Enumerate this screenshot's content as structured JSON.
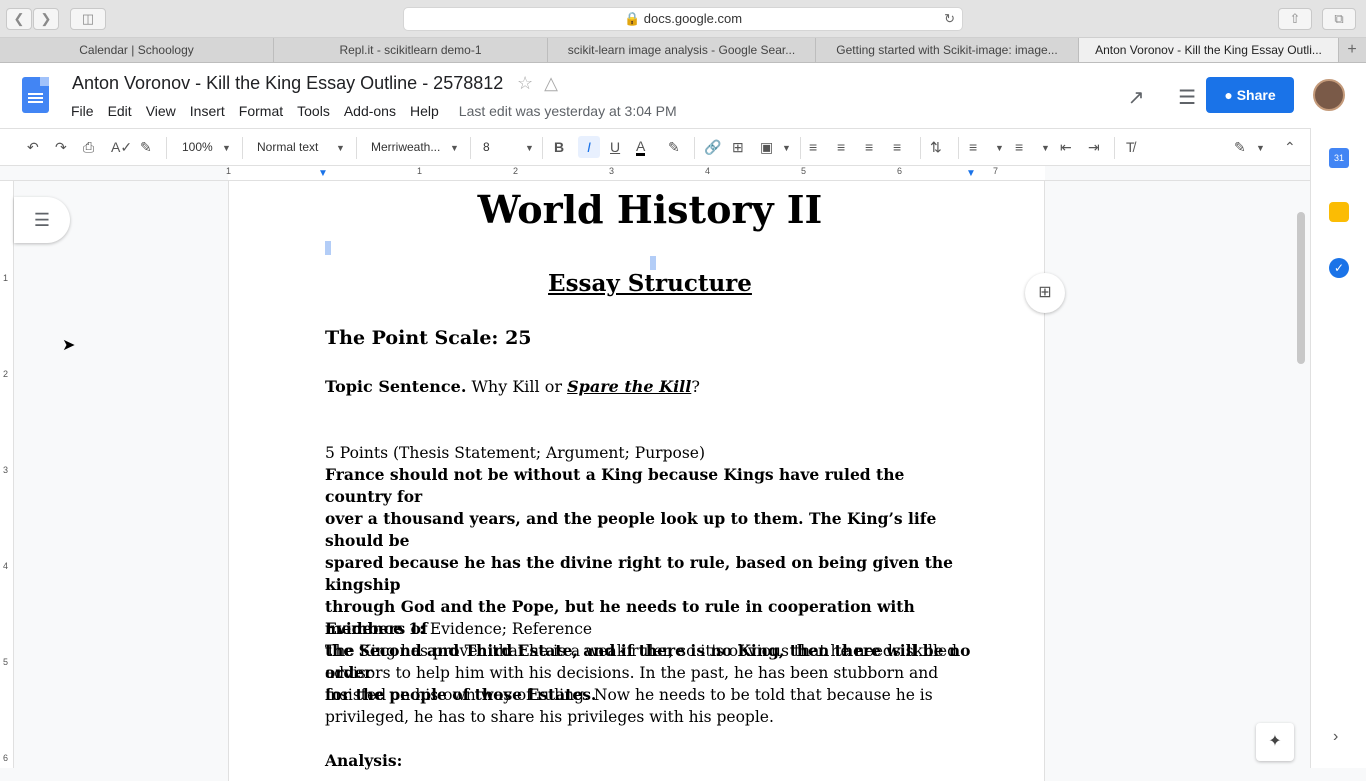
{
  "browser": {
    "url": "docs.google.com",
    "tabs": [
      "Calendar | Schoology",
      "Repl.it - scikitlearn demo-1",
      "scikit-learn image analysis - Google Sear...",
      "Getting started with Scikit-image: image...",
      "Anton Voronov - Kill the King Essay Outli..."
    ],
    "new_tab": "+"
  },
  "docs": {
    "title": "Anton Voronov - Kill the King Essay Outline - 2578812",
    "menu": [
      "File",
      "Edit",
      "View",
      "Insert",
      "Format",
      "Tools",
      "Add-ons",
      "Help"
    ],
    "last_edit": "Last edit was yesterday at 3:04 PM",
    "share_label": "Share"
  },
  "toolbar": {
    "zoom": "100%",
    "style": "Normal text",
    "font": "Merriweath...",
    "size": "8"
  },
  "ruler": {
    "h_numbers": [
      "1",
      "1",
      "2",
      "3",
      "4",
      "5",
      "6",
      "7"
    ],
    "v_numbers": [
      "1",
      "2",
      "3",
      "4",
      "5",
      "6"
    ]
  },
  "document": {
    "heading": "World History II",
    "subheading": "Essay Structure",
    "point_scale": "The Point Scale: 25",
    "topic_bold": "Topic Sentence.",
    "topic_text": " Why Kill or ",
    "topic_italic": "Spare the Kill",
    "topic_end": "?",
    "thesis_label": "5 Points (Thesis Statement; Argument; Purpose)",
    "thesis_lines": [
      "France should not be without a King because Kings have ruled the country for",
      "over a thousand years, and the people look up to them. The King’s life should be",
      "spared because  he has the divine right to rule, based on being given the kingship",
      "through God and the Pope, but he needs to rule in cooperation with members of",
      "the Second and Third Estate, and if there is no King, then there will be no order",
      "for the people of those Estates."
    ],
    "evidence_bold": "Evidence 1:",
    "evidence_label": " Evidence; Reference",
    "evidence_lines": [
      "The King has proven that he is a weak ruler, so it's obvious that he needs skilled",
      "advisors to help him with his decisions. In the past, he has been stubborn and",
      "insisted on his own way of ruling. Now he needs to be told that because he is",
      "privileged, he has to share his privileges with his people."
    ],
    "analysis": "Analysis:"
  }
}
